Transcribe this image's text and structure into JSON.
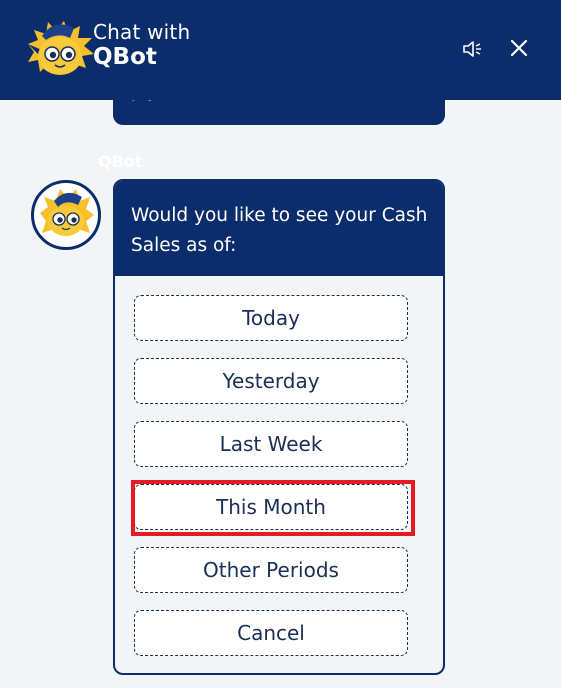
{
  "header": {
    "title_line1": "Chat with",
    "title_line2": "QBot",
    "speaker_icon": "speaker-icon",
    "close_icon": "close-icon",
    "mascot_icon": "qbot-mascot-icon"
  },
  "previous_message": {
    "text": "p                 y"
  },
  "message": {
    "sender": "QBot",
    "question": "Would you like to see your Cash Sales as of:",
    "options": [
      "Today",
      "Yesterday",
      "Last Week",
      "This Month",
      "Other Periods",
      "Cancel"
    ],
    "highlighted_option": "This Month"
  },
  "colors": {
    "header_bg": "#0c2d6b",
    "page_bg": "#f3f4f6",
    "option_text": "#1b2f55",
    "highlight": "#e31b23",
    "mascot": "#f5c02a"
  }
}
